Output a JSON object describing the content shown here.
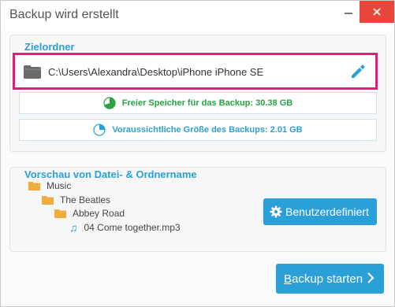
{
  "window": {
    "title": "Backup wird erstellt"
  },
  "target": {
    "heading": "Zielordner",
    "path": "C:\\Users\\Alexandra\\Desktop\\iPhone iPhone SE",
    "free_space": "Freier Speicher für das Backup: 30.38 GB",
    "estimated_size": "Voraussichtliche Größe des Backups: 2.01 GB"
  },
  "preview": {
    "heading": "Vorschau von Datei- & Ordnername",
    "tree": [
      "Music",
      "The Beatles",
      "Abbey Road",
      "04 Come together.mp3"
    ]
  },
  "buttons": {
    "custom_label": "Benutzerdefiniert",
    "start_first_letter": "B",
    "start_rest": "ackup starten"
  },
  "colors": {
    "accent": "#2a9fd8",
    "highlight_border": "#e8197a",
    "free_text": "#2aa244",
    "close_button": "#e8463a"
  },
  "icons": [
    "folder-icon",
    "pencil-icon",
    "pie-chart-icon",
    "music-note-icon",
    "gear-icon",
    "chevron-right-icon",
    "close-icon",
    "minimize-icon"
  ]
}
